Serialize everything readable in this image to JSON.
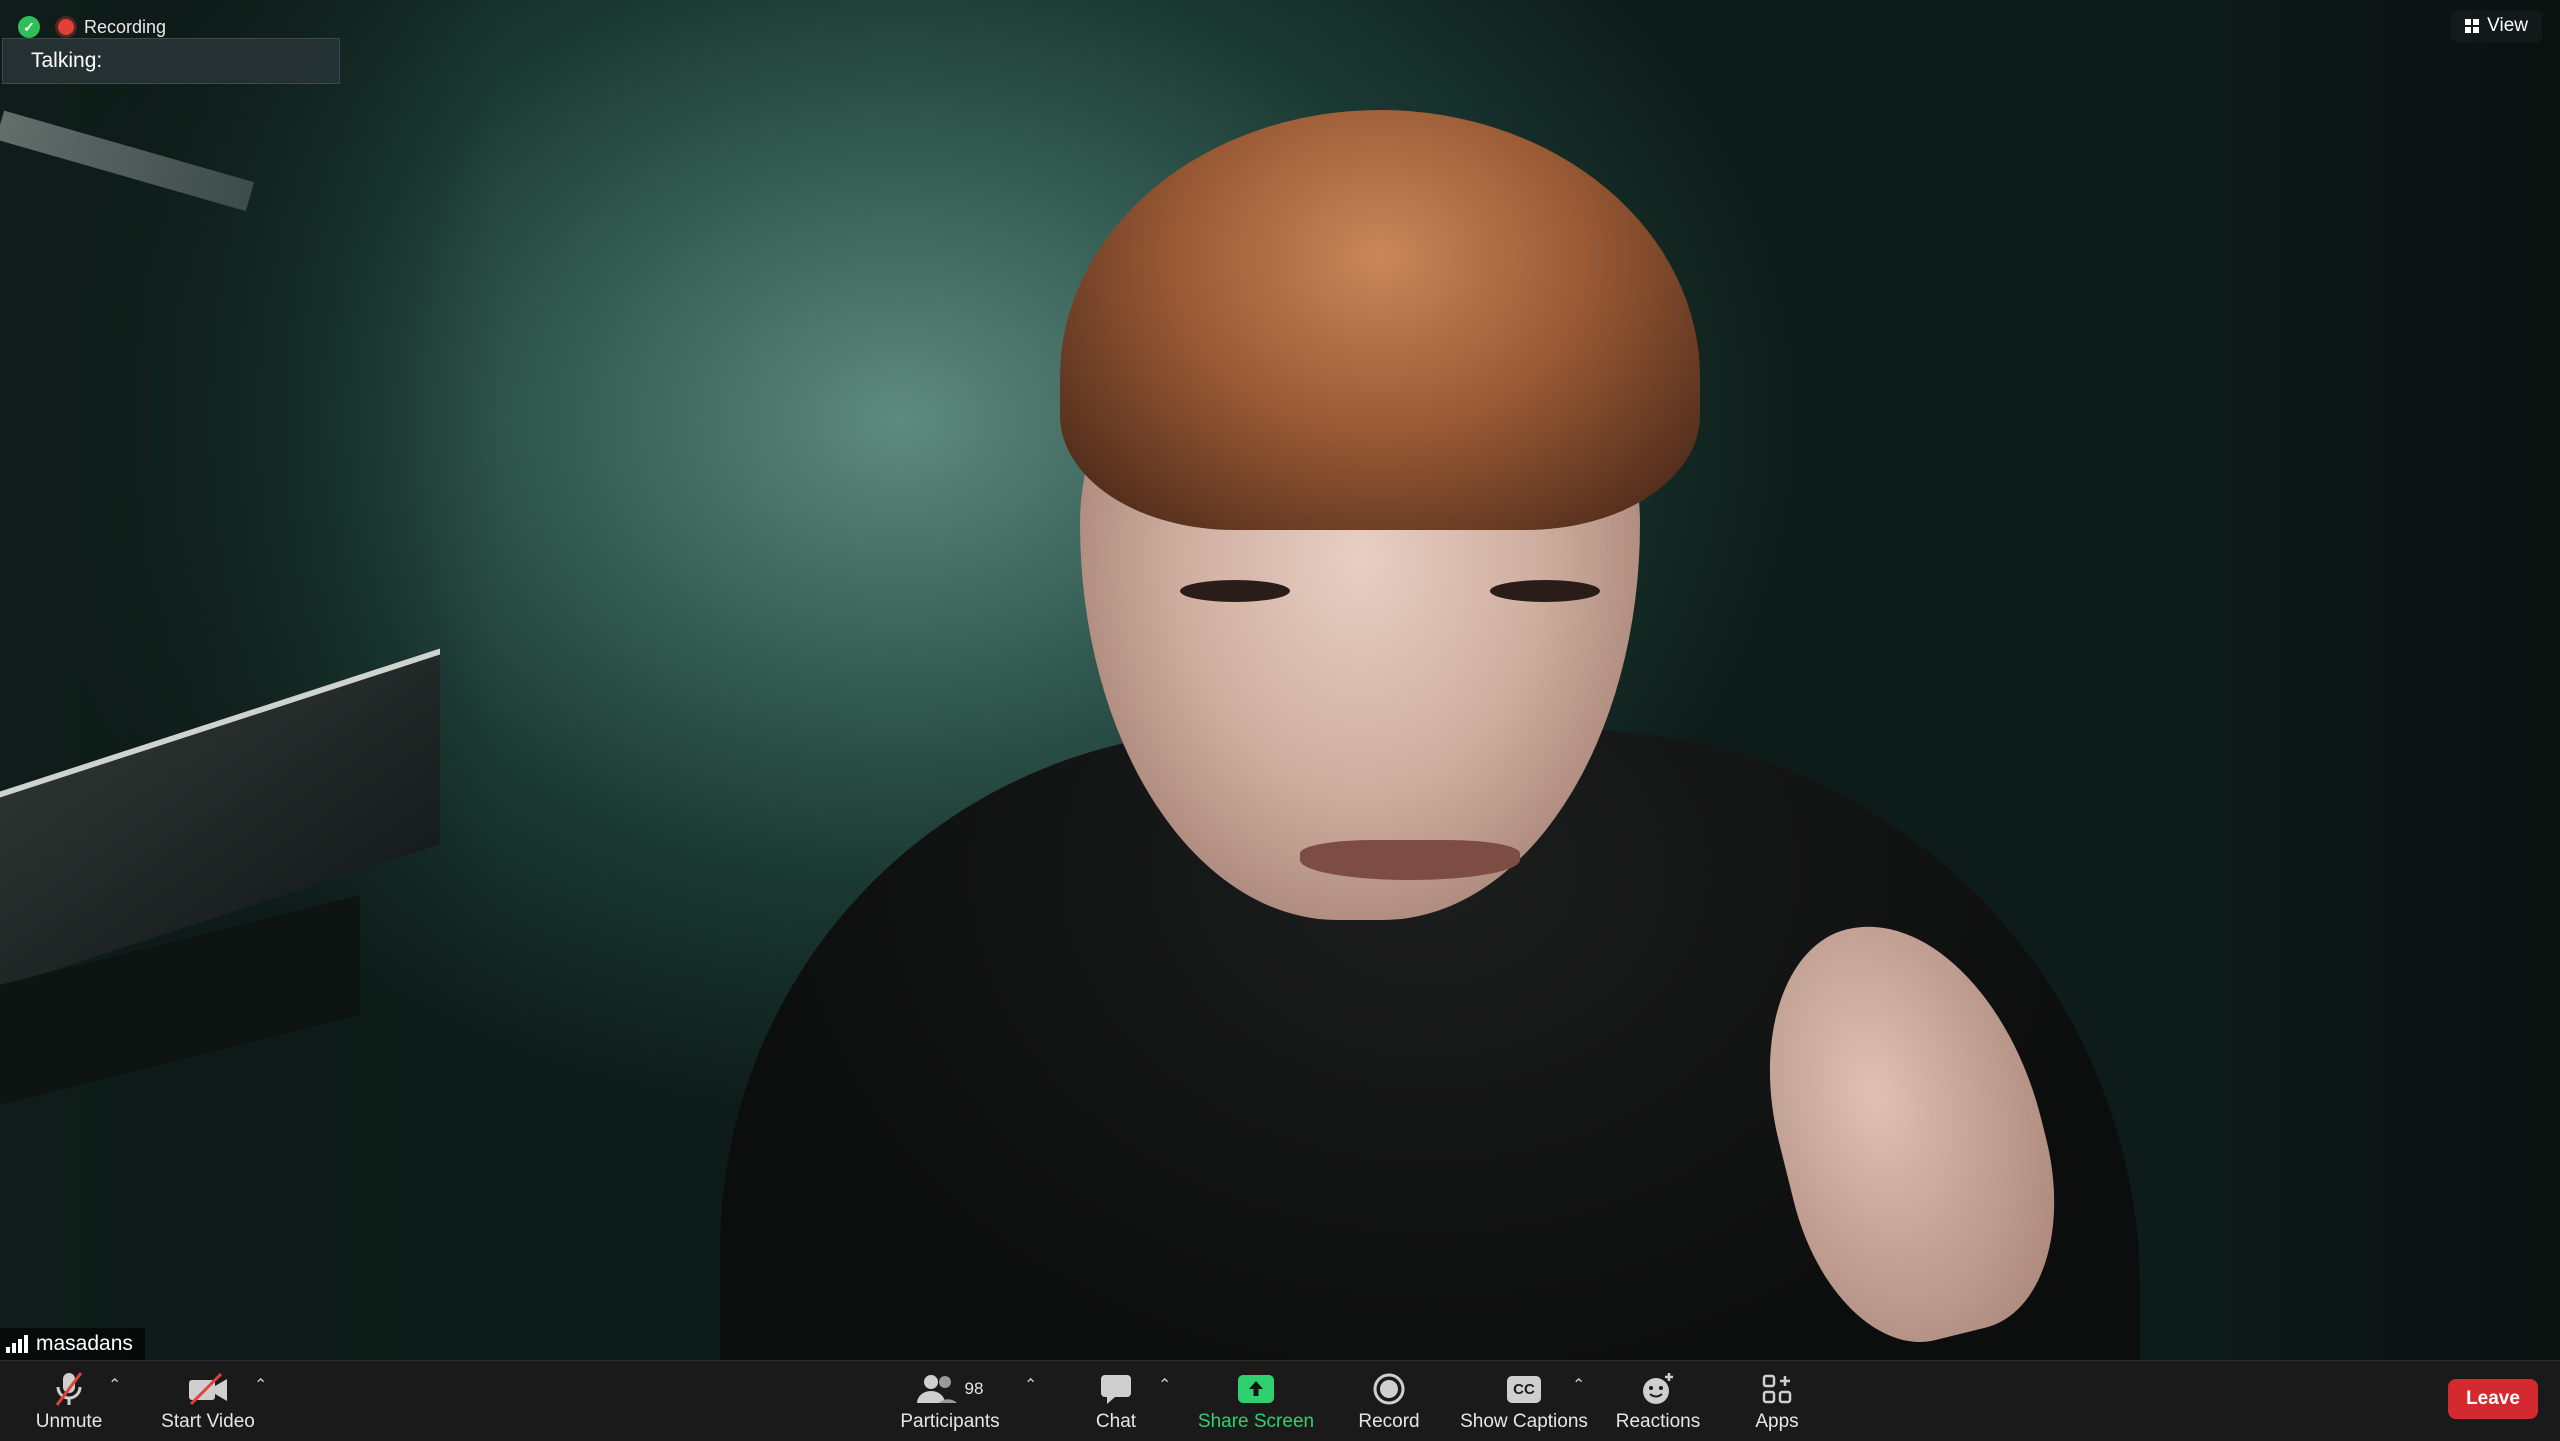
{
  "status": {
    "recording_label": "Recording",
    "talking_label": "Talking:",
    "view_label": "View"
  },
  "participant": {
    "name": "masadans"
  },
  "toolbar": {
    "unmute_label": "Unmute",
    "start_video_label": "Start Video",
    "participants_label": "Participants",
    "participants_count": "98",
    "chat_label": "Chat",
    "share_screen_label": "Share Screen",
    "record_label": "Record",
    "captions_label": "Show Captions",
    "captions_icon_text": "CC",
    "reactions_label": "Reactions",
    "apps_label": "Apps",
    "leave_label": "Leave"
  },
  "colors": {
    "share_accent": "#2fd16e",
    "leave_red": "#d3292f",
    "recording_red": "#e0423a",
    "security_green": "#2fbf5a"
  },
  "icons": [
    "shield-icon",
    "recording-icon",
    "grid-icon",
    "signal-icon",
    "microphone-muted-icon",
    "video-off-icon",
    "participants-icon",
    "chat-icon",
    "share-screen-icon",
    "record-icon",
    "captions-icon",
    "reactions-icon",
    "apps-icon",
    "chevron-up-icon"
  ]
}
